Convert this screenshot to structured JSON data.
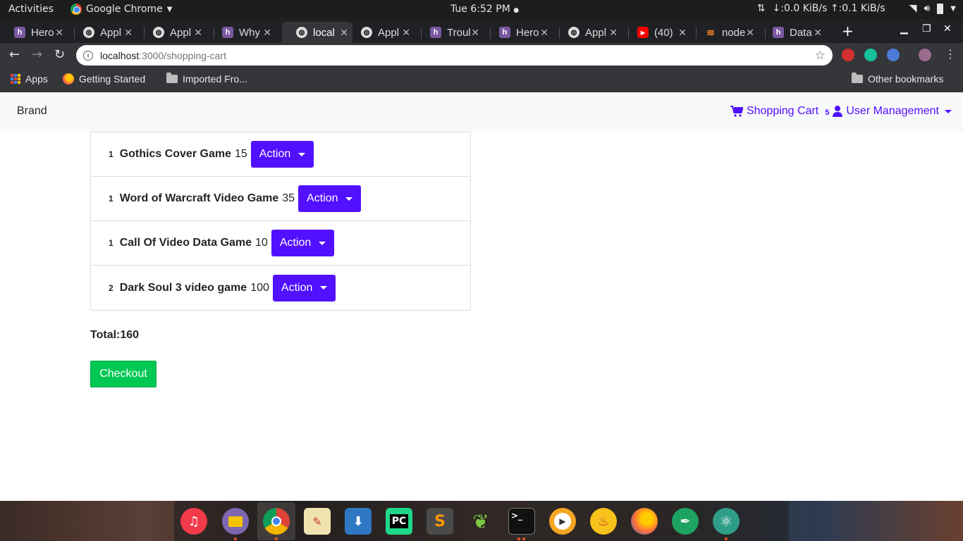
{
  "system_bar": {
    "activities": "Activities",
    "app_name": "Google Chrome",
    "clock": "Tue  6:52 PM",
    "net_speed": "↓:0.0 KiB/s ↑:0.1 KiB/s"
  },
  "tabs": [
    {
      "title": "Hero",
      "icon": "heroku-icon"
    },
    {
      "title": "Appl",
      "icon": "globe-icon"
    },
    {
      "title": "Appl",
      "icon": "globe-icon"
    },
    {
      "title": "Why",
      "icon": "heroku-icon"
    },
    {
      "title": "local",
      "icon": "globe-icon",
      "active": true
    },
    {
      "title": "Appl",
      "icon": "globe-icon"
    },
    {
      "title": "Troul",
      "icon": "heroku-icon"
    },
    {
      "title": "Hero",
      "icon": "heroku-icon"
    },
    {
      "title": "Appl",
      "icon": "globe-icon"
    },
    {
      "title": "(40)",
      "icon": "youtube-icon"
    },
    {
      "title": "node",
      "icon": "stackoverflow-icon"
    },
    {
      "title": "Data",
      "icon": "heroku-icon"
    }
  ],
  "address_bar": {
    "host": "localhost",
    "path": ":3000/shopping-cart"
  },
  "bookmarks": {
    "apps": "Apps",
    "getting_started": "Getting Started",
    "imported": "Imported Fro...",
    "other": "Other bookmarks"
  },
  "navbar": {
    "brand": "Brand",
    "cart_label": "Shopping Cart",
    "cart_count": "5",
    "user_management": "User Management"
  },
  "cart": {
    "items": [
      {
        "qty": "1",
        "name": "Gothics Cover Game",
        "price": "15",
        "action": "Action"
      },
      {
        "qty": "1",
        "name": "Word of Warcraft Video Game",
        "price": "35",
        "action": "Action"
      },
      {
        "qty": "1",
        "name": "Call Of Video Data Game",
        "price": "10",
        "action": "Action"
      },
      {
        "qty": "2",
        "name": "Dark Soul 3 video game",
        "price": "100",
        "action": "Action"
      }
    ],
    "total": "Total:160",
    "checkout": "Checkout"
  },
  "colors": {
    "accent": "#5110ff",
    "checkout": "#00c853"
  }
}
